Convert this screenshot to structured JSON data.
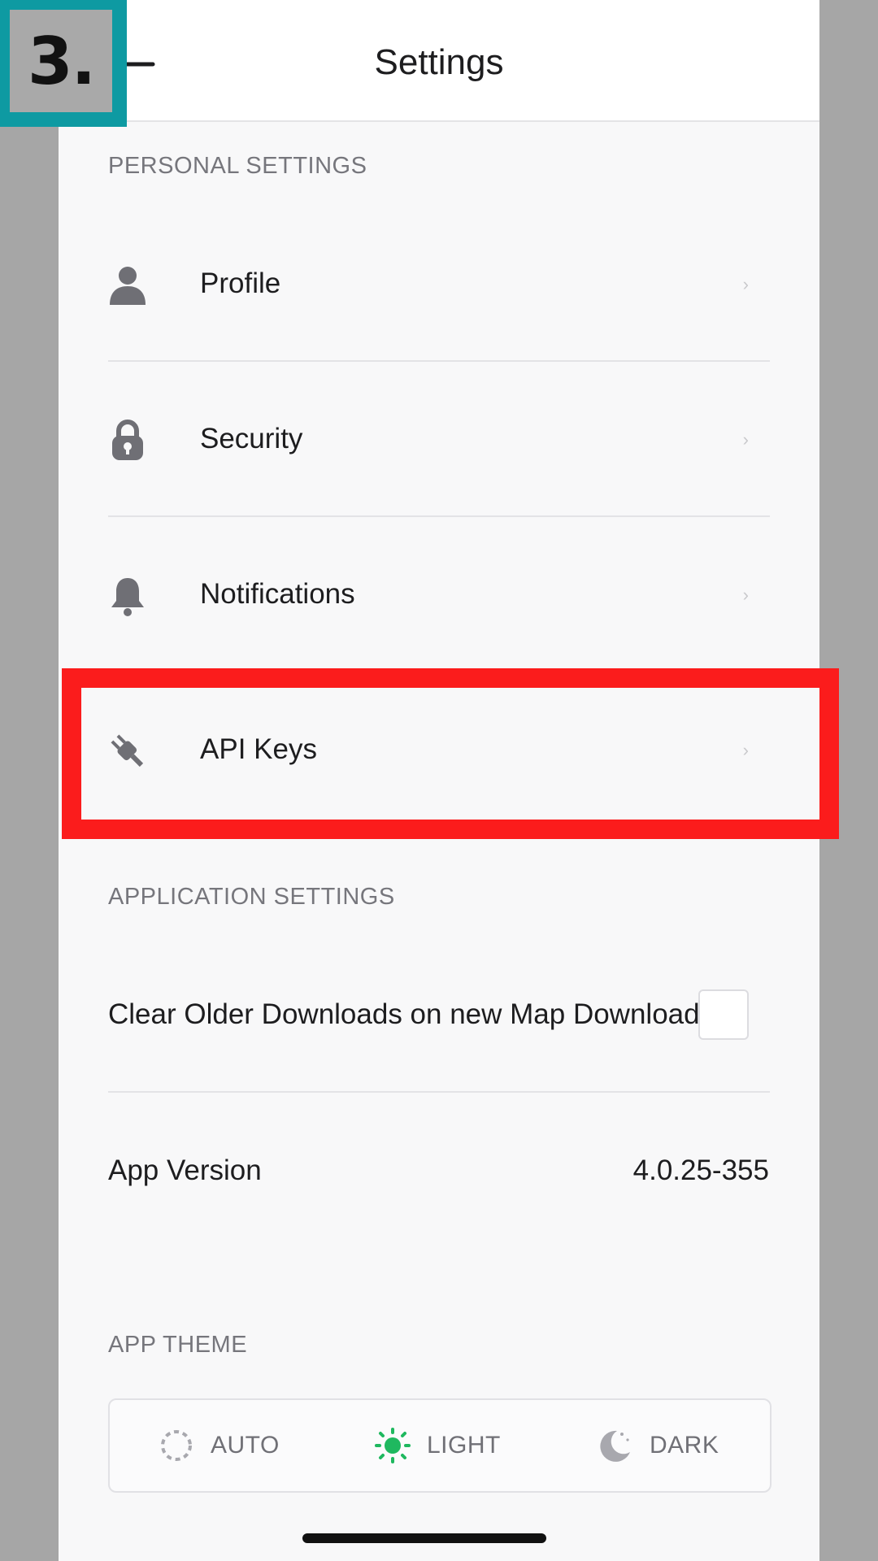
{
  "step_badge": "3.",
  "header": {
    "title": "Settings"
  },
  "personal_section": {
    "label": "PERSONAL SETTINGS",
    "items": [
      {
        "label": "Profile",
        "icon": "person-icon"
      },
      {
        "label": "Security",
        "icon": "lock-icon"
      },
      {
        "label": "Notifications",
        "icon": "bell-icon"
      },
      {
        "label": "API Keys",
        "icon": "plug-icon"
      }
    ]
  },
  "application_section": {
    "label": "APPLICATION SETTINGS",
    "clear_downloads_label": "Clear Older Downloads on new Map Download",
    "clear_downloads_checked": false,
    "app_version_label": "App Version",
    "app_version_value": "4.0.25-355"
  },
  "theme_section": {
    "label": "APP THEME",
    "options": [
      {
        "label": "AUTO",
        "icon": "auto-theme-icon",
        "selected": false
      },
      {
        "label": "LIGHT",
        "icon": "sun-icon",
        "selected": true
      },
      {
        "label": "DARK",
        "icon": "moon-icon",
        "selected": false
      }
    ]
  },
  "colors": {
    "highlight": "#fb1c1c",
    "badge": "#0e9aa2",
    "selected_theme": "#1fb85f",
    "icon_gray": "#6f6f75"
  }
}
